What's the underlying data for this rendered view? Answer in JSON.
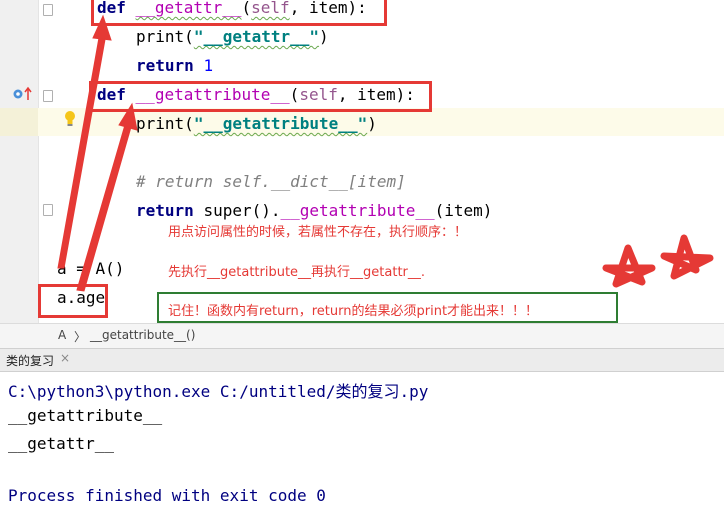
{
  "editor": {
    "lines": {
      "def_getattr": {
        "kw": "def",
        "name": "__getattr__",
        "open": "(",
        "self": "self",
        "rest": ", item):"
      },
      "print_getattr": {
        "fn": "print",
        "open": "(",
        "str": "\"__getattr__\"",
        "close": ")"
      },
      "return_one": {
        "kw": "return",
        "num": "1"
      },
      "def_getattribute": {
        "kw": "def",
        "name": "__getattribute__",
        "open": "(",
        "self": "self",
        "rest": ", item):"
      },
      "print_getattribute": {
        "fn": "print",
        "open": "(",
        "str": "\"__getattribute__\"",
        "close": ")"
      },
      "comment": "# return self.__dict__[item]",
      "return_super": {
        "kw": "return",
        "text1": "super().",
        "name": "__getattribute__",
        "text2": "(item)"
      },
      "assign": "a = A()",
      "access": "a.age"
    },
    "notes": {
      "order": "用点访问属性的时候，若属性不存在，执行顺序：！",
      "sequence": "先执行__getattribute__再执行__getattr__.",
      "remember": "记住！函数内有return，return的结果必须print才能出来！！！"
    }
  },
  "breadcrumb": {
    "class": "A",
    "sep": "〉",
    "method": "__getattribute__()"
  },
  "run_tab": {
    "label": "类的复习",
    "close": "×"
  },
  "console": {
    "lines": [
      "C:\\python3\\python.exe C:/untitled/类的复习.py",
      "__getattribute__",
      "__getattr__",
      "",
      "Process finished with exit code 0"
    ]
  },
  "colors": {
    "annotation_red": "#e53935",
    "annotation_green": "#2e7d32"
  }
}
